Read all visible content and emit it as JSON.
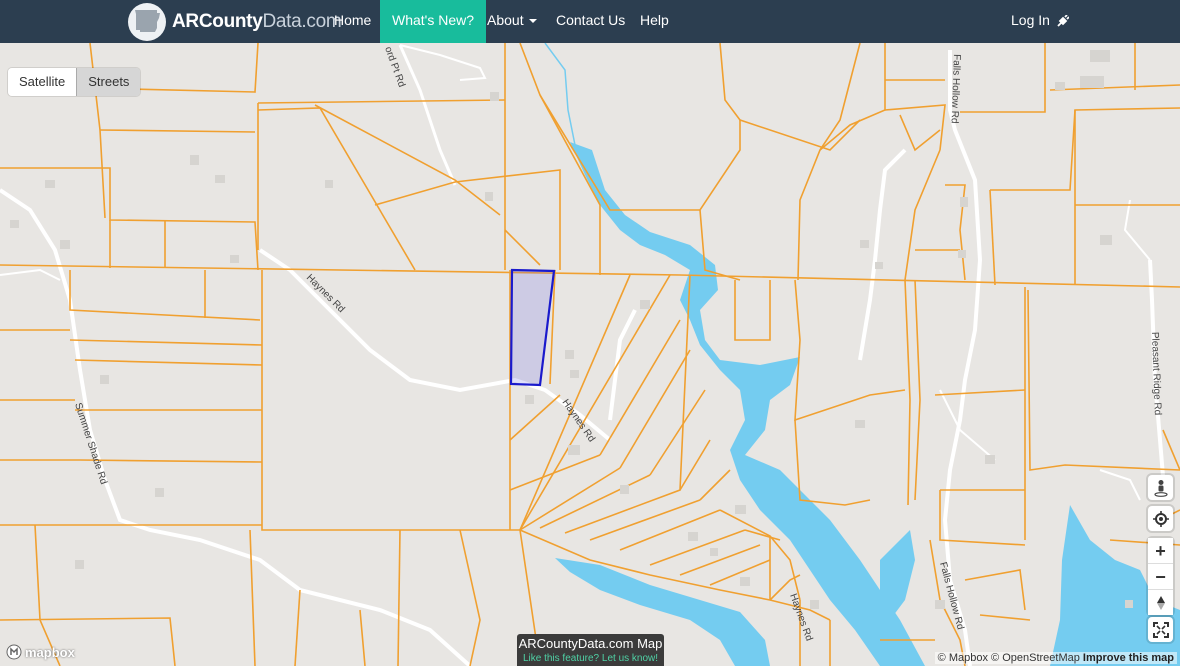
{
  "brand": {
    "name_bold": "ARCounty",
    "name_light": "Data.com"
  },
  "nav": {
    "home": "Home",
    "whats_new": "What's New?",
    "about": "About",
    "contact": "Contact Us",
    "help": "Help",
    "login": "Log In"
  },
  "layers": {
    "satellite": "Satellite",
    "streets": "Streets",
    "selected": "Streets"
  },
  "roads": {
    "haynes_1": "Haynes Rd",
    "haynes_2": "Haynes Rd",
    "haynes_3": "Haynes Rd",
    "summer_shade": "Summer Shade Rd",
    "falls_hollow_1": "Falls Hollow Rd",
    "falls_hollow_2": "Falls Hollow Rd",
    "pleasant_ridge": "Pleasant Ridge Rd",
    "ford_pt": "ord Pt Rd"
  },
  "controls": {
    "street_view_icon": "pegman-icon",
    "locate_icon": "crosshair-icon",
    "zoom_in": "+",
    "zoom_out": "−",
    "compass_icon": "compass-icon",
    "fullscreen_icon": "fullscreen-icon"
  },
  "attribution": {
    "mapbox": "© Mapbox",
    "osm": "© OpenStreetMap",
    "improve": "Improve this map"
  },
  "mapbox_logo": "mapbox",
  "caption": {
    "title": "ARCountyData.com Map",
    "subtitle": "Like this feature? Let us know!"
  },
  "colors": {
    "nav_bg": "#2c3e50",
    "active": "#18bc9c",
    "parcel_line": "#f0a030",
    "water": "#74ccf0",
    "selection": "#1a1acc",
    "land": "#e8e6e3"
  }
}
